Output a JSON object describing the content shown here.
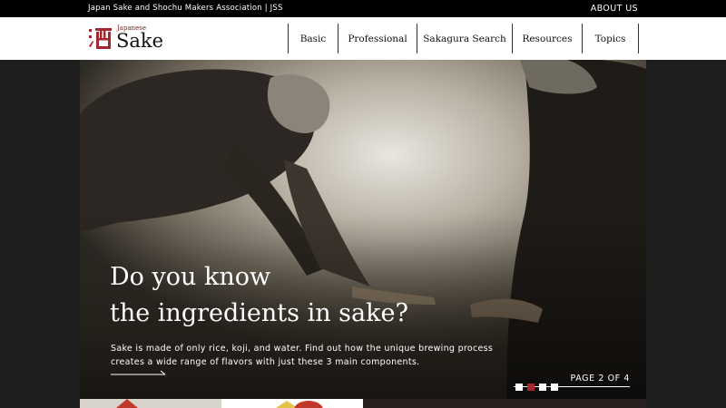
{
  "topbar": {
    "org": "Japan Sake and Shochu Makers Association | JSS",
    "about": "ABOUT US"
  },
  "logo": {
    "small": "Japanese",
    "big": "Sake",
    "brand_color": "#a3282f"
  },
  "nav": [
    {
      "label": "Basic"
    },
    {
      "label": "Professional"
    },
    {
      "label": "Sakagura Search"
    },
    {
      "label": "Resources"
    },
    {
      "label": "Topics"
    }
  ],
  "hero": {
    "headline_line1": "Do you know",
    "headline_line2": "the ingredients in sake?",
    "description": "Sake is made of only rice, koji, and water. Find out how the unique brewing process creates a wide range of flavors with just these 3 main components.",
    "page_label": "PAGE 2 OF 4",
    "slide_count": 4,
    "active_slide": 2
  }
}
